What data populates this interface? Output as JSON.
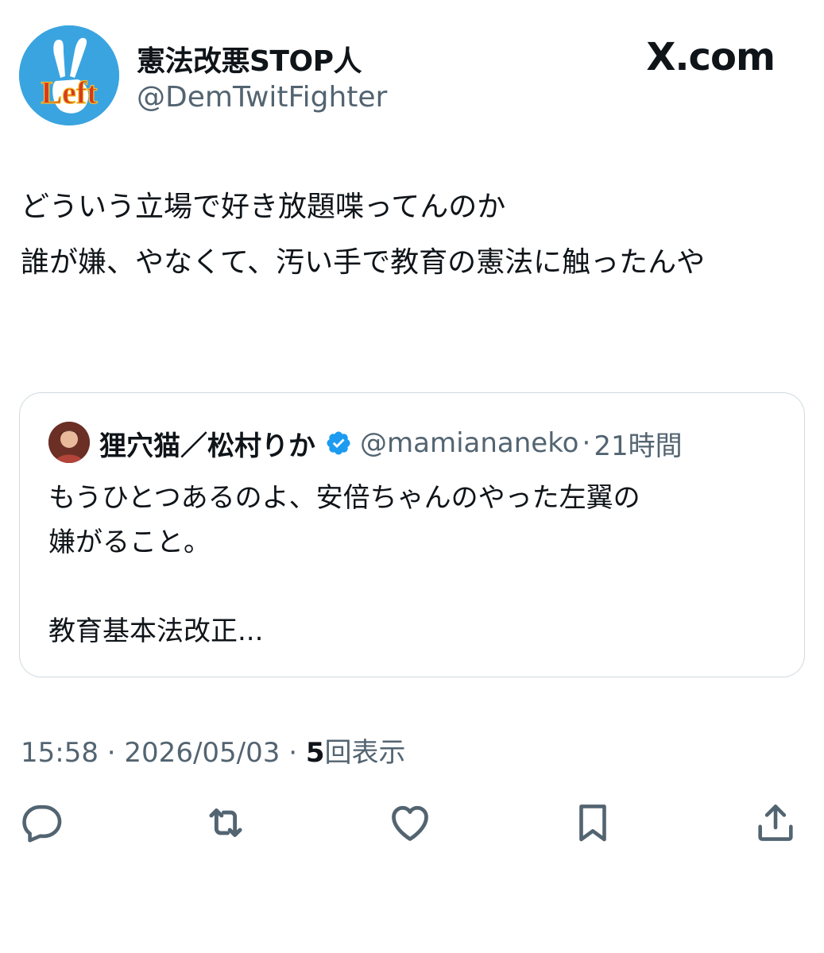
{
  "header": {
    "display_name": "憲法改悪STOP人",
    "handle": "@DemTwitFighter",
    "brand": "X.com",
    "avatar_text": "Left"
  },
  "tweet": {
    "text": "どういう立場で好き放題喋ってんのか\n誰が嫌、やなくて、汚い手で教育の憲法に触ったんや"
  },
  "quote": {
    "name": "狸穴猫／松村りか",
    "handle": "@mamiananeko",
    "separator": "·",
    "time": "21時間",
    "text": "もうひとつあるのよ、安倍ちゃんのやった左翼の\n嫌がること。\n\n教育基本法改正..."
  },
  "meta": {
    "time": "15:58",
    "date": "2026/05/03",
    "views_count": "5",
    "views_label": "回表示",
    "separator": "·"
  },
  "actions": [
    "reply-icon",
    "repost-icon",
    "like-icon",
    "bookmark-icon",
    "share-icon"
  ],
  "colors": {
    "text": "#0f1419",
    "secondary": "#536471",
    "border": "#cfd9de",
    "verified": "#1d9bf0",
    "avatar_bg": "#3aa4e0",
    "avatar_text": "#d83a1e"
  }
}
